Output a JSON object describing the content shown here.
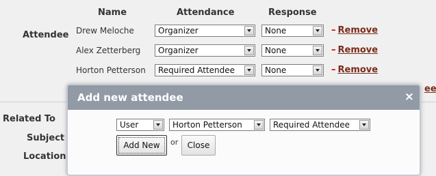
{
  "form": {
    "columns": {
      "name": "Name",
      "attendance": "Attendance",
      "response": "Response"
    },
    "labels": {
      "attendee": "Attendee",
      "related_to": "Related To",
      "subject": "Subject",
      "location": "Location"
    },
    "attendees": [
      {
        "name": "Drew Meloche",
        "attendance": "Organizer",
        "response": "None",
        "remove": "Remove"
      },
      {
        "name": "Alex Zetterberg",
        "attendance": "Organizer",
        "response": "None",
        "remove": "Remove"
      },
      {
        "name": "Horton Petterson",
        "attendance": "Required Attendee",
        "response": "None",
        "remove": "Remove"
      }
    ],
    "partial_link": "ee"
  },
  "modal": {
    "title": "Add new attendee",
    "close_glyph": "×",
    "type_select": "User",
    "person_select": "Horton Petterson",
    "attendance_select": "Required Attendee",
    "add_button": "Add New",
    "or_text": "or",
    "close_button": "Close"
  },
  "icons": {
    "close": "close-icon",
    "dropdown": "chevron-down-icon"
  },
  "colors": {
    "modal_header": "#929aa6",
    "remove_dash": "#d20000",
    "link": "#7a2b1a",
    "page_bg": "#f0f0f0"
  }
}
